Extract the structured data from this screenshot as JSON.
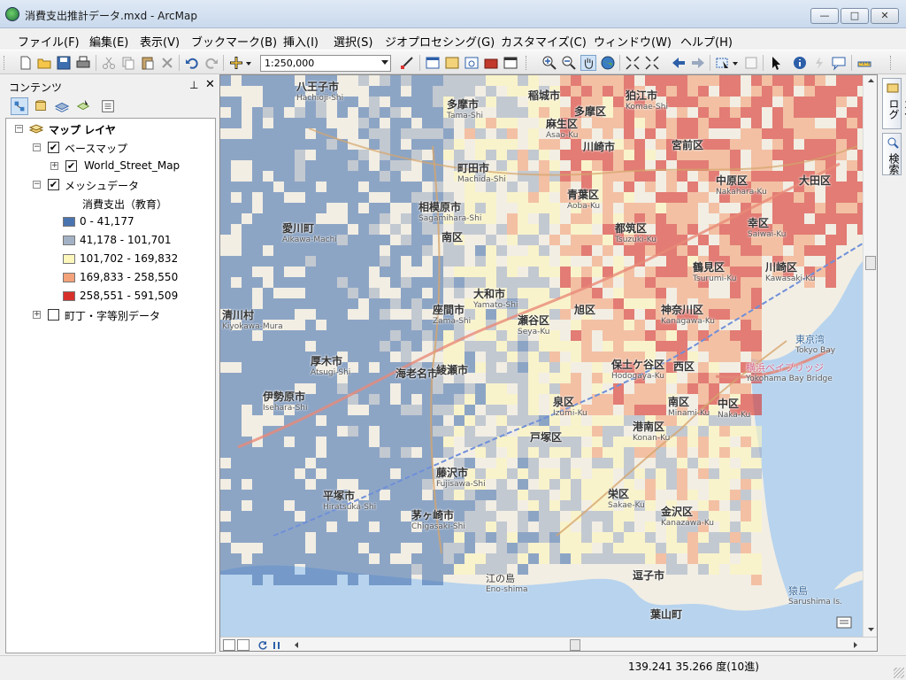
{
  "window": {
    "title": "消費支出推計データ.mxd - ArcMap",
    "controls": {
      "minimize": "—",
      "maximize": "□",
      "close": "✕"
    }
  },
  "menu": [
    "ファイル(F)",
    "編集(E)",
    "表示(V)",
    "ブックマーク(B)",
    "挿入(I)",
    "選択(S)",
    "ジオプロセシング(G)",
    "カスタマイズ(C)",
    "ウィンドウ(W)",
    "ヘルプ(H)"
  ],
  "toolbar": {
    "scale": "1:250,000"
  },
  "toc": {
    "title": "コンテンツ",
    "pin": "⊥",
    "close": "✕",
    "root": "マップ レイヤ",
    "layers": {
      "basemap_group": "ベースマップ",
      "basemap": "World_Street_Map",
      "mesh": "メッシュデータ",
      "field": "消費支出（教育）",
      "classes": [
        {
          "label": "0 - 41,177",
          "color": "#4a74b0"
        },
        {
          "label": "41,178 - 101,701",
          "color": "#a3b1c4"
        },
        {
          "label": "101,702 - 169,832",
          "color": "#fdf7bb"
        },
        {
          "label": "169,833 - 258,550",
          "color": "#f4a27a"
        },
        {
          "label": "258,551 - 591,509",
          "color": "#d7302a"
        }
      ],
      "town": "町丁・字等別データ"
    }
  },
  "map": {
    "labels": [
      {
        "ja": "八王子市",
        "en": "Hachioji-Shi"
      },
      {
        "ja": "多摩市",
        "en": "Tama-Shi"
      },
      {
        "ja": "稲城市",
        "en": ""
      },
      {
        "ja": "狛江市",
        "en": "Komae-Shi"
      },
      {
        "ja": "多摩区",
        "en": ""
      },
      {
        "ja": "麻生区",
        "en": "Asao-Ku"
      },
      {
        "ja": "川崎市",
        "en": ""
      },
      {
        "ja": "宮前区",
        "en": ""
      },
      {
        "ja": "町田市",
        "en": "Machida-Shi"
      },
      {
        "ja": "相模原市",
        "en": "Sagamihara-Shi"
      },
      {
        "ja": "南区",
        "en": ""
      },
      {
        "ja": "青葉区",
        "en": "Aoba-Ku"
      },
      {
        "ja": "都筑区",
        "en": "Tsuzuki-Ku"
      },
      {
        "ja": "中原区",
        "en": "Nakahara-Ku"
      },
      {
        "ja": "大田区",
        "en": ""
      },
      {
        "ja": "幸区",
        "en": "Saiwai-Ku"
      },
      {
        "ja": "川崎区",
        "en": "Kawasaki-Ku"
      },
      {
        "ja": "鶴見区",
        "en": "Tsurumi-Ku"
      },
      {
        "ja": "愛川町",
        "en": "Aikawa-Machi"
      },
      {
        "ja": "座間市",
        "en": "Zama-Shi"
      },
      {
        "ja": "大和市",
        "en": "Yamato-Shi"
      },
      {
        "ja": "瀬谷区",
        "en": "Seya-Ku"
      },
      {
        "ja": "旭区",
        "en": ""
      },
      {
        "ja": "神奈川区",
        "en": "Kanagawa-Ku"
      },
      {
        "ja": "清川村",
        "en": "Kiyokawa-Mura"
      },
      {
        "ja": "厚木市",
        "en": "Atsugi-Shi"
      },
      {
        "ja": "海老名市",
        "en": ""
      },
      {
        "ja": "綾瀬市",
        "en": ""
      },
      {
        "ja": "保土ケ谷区",
        "en": "Hodogaya-Ku"
      },
      {
        "ja": "西区",
        "en": ""
      },
      {
        "ja": "伊勢原市",
        "en": "Isehara-Shi"
      },
      {
        "ja": "泉区",
        "en": "Izumi-Ku"
      },
      {
        "ja": "南区",
        "en": "Minami-Ku"
      },
      {
        "ja": "中区",
        "en": "Naka-Ku"
      },
      {
        "ja": "戸塚区",
        "en": ""
      },
      {
        "ja": "港南区",
        "en": "Konan-Ku"
      },
      {
        "ja": "藤沢市",
        "en": "Fujisawa-Shi"
      },
      {
        "ja": "栄区",
        "en": "Sakae-Ku"
      },
      {
        "ja": "平塚市",
        "en": "Hiratsuka-Shi"
      },
      {
        "ja": "茅ヶ崎市",
        "en": "Chigasaki-Shi"
      },
      {
        "ja": "金沢区",
        "en": "Kanazawa-Ku"
      },
      {
        "ja": "江の島",
        "en": "Eno-shima"
      },
      {
        "ja": "逗子市",
        "en": ""
      },
      {
        "ja": "葉山町",
        "en": ""
      },
      {
        "ja": "猿島",
        "en": "Sarushima Is."
      },
      {
        "ja": "東京湾",
        "en": "Tokyo Bay"
      },
      {
        "ja": "横浜ベイブリッジ",
        "en": "Yokohama Bay Bridge"
      }
    ]
  },
  "sidetabs": [
    "カタログ",
    "検索"
  ],
  "status": {
    "coords": "139.241  35.266 度(10進)"
  }
}
